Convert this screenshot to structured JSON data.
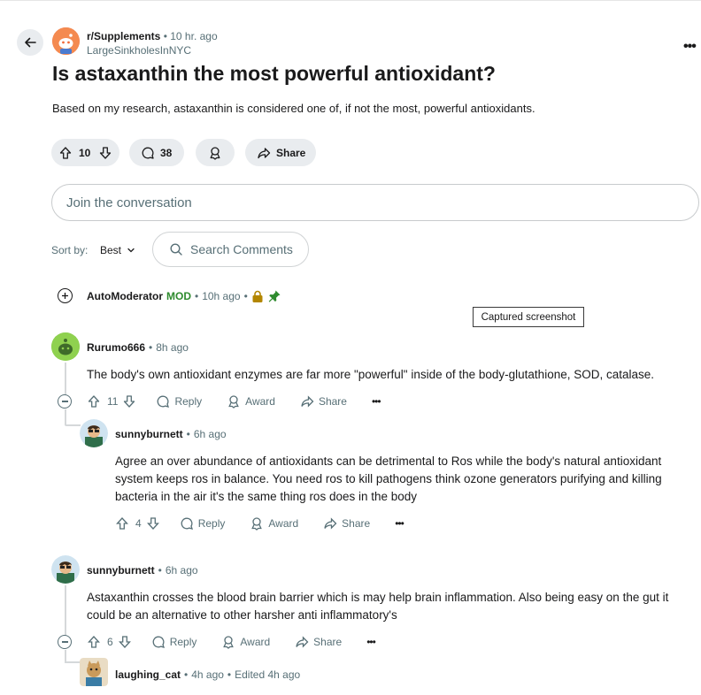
{
  "post": {
    "subreddit": "r/Supplements",
    "time": "10 hr. ago",
    "author": "LargeSinkholesInNYC",
    "title": "Is astaxanthin the most powerful antioxidant?",
    "body": "Based on my research, astaxanthin is considered one of, if not the most, powerful antioxidants.",
    "votes": "10",
    "comments": "38",
    "share_label": "Share"
  },
  "join_placeholder": "Join the conversation",
  "sort": {
    "label": "Sort by:",
    "value": "Best"
  },
  "search_comments": "Search Comments",
  "tooltip": "Captured screenshot",
  "comments": [
    {
      "author": "AutoModerator",
      "badge": "MOD",
      "time": "10h ago"
    },
    {
      "author": "Rurumo666",
      "time": "8h ago",
      "text": "The body's own antioxidant enzymes are far more \"powerful\" inside of the body-glutathione, SOD, catalase.",
      "votes": "11",
      "reply": "Reply",
      "award": "Award",
      "share": "Share"
    },
    {
      "author": "sunnyburnett",
      "time": "6h ago",
      "text_lines": [
        "Agree an over abundance of antioxidants can be detrimental to Ros while the body's natural antioxidant",
        "system keeps ros in balance. You need ros to kill pathogens think ozone generators purifying and killing",
        "bacteria in the air it's the same thing ros does in the body"
      ],
      "votes": "4",
      "reply": "Reply",
      "award": "Award",
      "share": "Share"
    },
    {
      "author": "sunnyburnett",
      "time": "6h ago",
      "text_lines": [
        "Astaxanthin crosses the blood brain barrier which is may help brain inflammation. Also being easy on the gut it",
        "could be an alternative to other harsher anti inflammatory's"
      ],
      "votes": "6",
      "reply": "Reply",
      "award": "Award",
      "share": "Share"
    },
    {
      "author": "laughing_cat",
      "time": "4h ago",
      "edited": "Edited 4h ago"
    }
  ],
  "colors": {
    "mod_green": "#2e8b2e",
    "pin_green": "#2e8b2e",
    "lock_gold": "#b38600"
  },
  "icons": [
    "back-arrow-icon",
    "more-icon",
    "upvote-icon",
    "downvote-icon",
    "comment-icon",
    "award-icon",
    "share-icon",
    "search-icon",
    "chevron-down-icon",
    "plus-circle-icon",
    "minus-circle-icon",
    "lock-icon",
    "pin-icon"
  ]
}
